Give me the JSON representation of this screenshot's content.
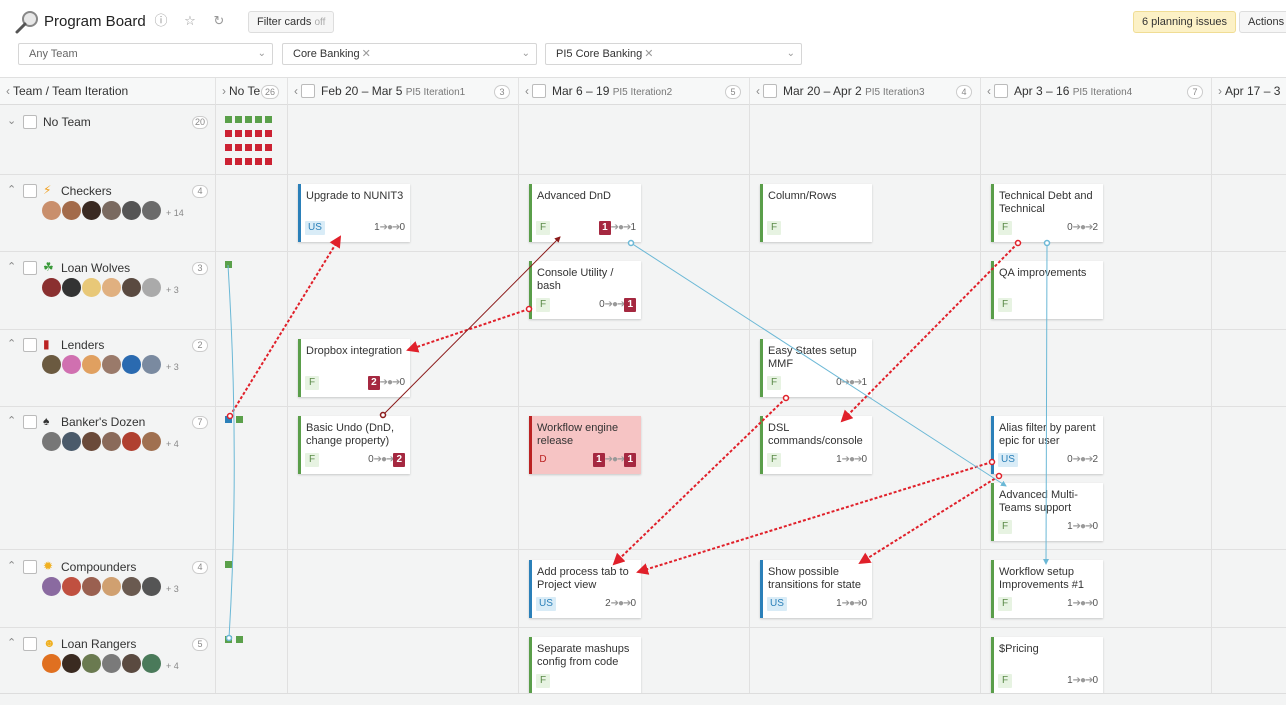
{
  "header": {
    "title": "Program Board",
    "filter_label": "Filter cards",
    "filter_state": "off",
    "planning_issues": "6 planning issues",
    "actions": "Actions"
  },
  "filters": {
    "team": "Any Team",
    "project": "Core Banking",
    "release": "PI5 Core Banking"
  },
  "columns": [
    {
      "label": "Team / Team Iteration"
    },
    {
      "label": "No Te",
      "count": "26"
    },
    {
      "label": "Feb 20 – Mar 5",
      "pi": "PI5 Iteration1",
      "count": "3"
    },
    {
      "label": "Mar 6 – 19",
      "pi": "PI5 Iteration2",
      "count": "5"
    },
    {
      "label": "Mar 20 – Apr 2",
      "pi": "PI5 Iteration3",
      "count": "4"
    },
    {
      "label": "Apr 3 – 16",
      "pi": "PI5 Iteration4",
      "count": "7"
    },
    {
      "label": "Apr 17 – 3"
    }
  ],
  "teams": [
    {
      "name": "No Team",
      "count": "20",
      "icon": "",
      "more": ""
    },
    {
      "name": "Checkers",
      "count": "4",
      "icon": "lightning-icon",
      "more": "+ 14"
    },
    {
      "name": "Loan Wolves",
      "count": "3",
      "icon": "clover-icon",
      "more": "+ 3"
    },
    {
      "name": "Lenders",
      "count": "2",
      "icon": "book-icon",
      "more": "+ 3"
    },
    {
      "name": "Banker's Dozen",
      "count": "7",
      "icon": "spade-icon",
      "more": "+ 4"
    },
    {
      "name": "Compounders",
      "count": "4",
      "icon": "sun-icon",
      "more": "+ 3"
    },
    {
      "name": "Loan Rangers",
      "count": "5",
      "icon": "sunglasses-icon",
      "more": "+ 4"
    }
  ],
  "cards": [
    {
      "title": "Upgrade to NUNIT3",
      "type": "US",
      "deps_in": "1",
      "deps_out": "0"
    },
    {
      "title": "Advanced DnD",
      "type": "F",
      "deps_in": "1",
      "deps_out": "1"
    },
    {
      "title": "Column/Rows",
      "type": "F",
      "deps_in": "",
      "deps_out": ""
    },
    {
      "title": "Technical Debt and Technical",
      "type": "F",
      "deps_in": "0",
      "deps_out": "2"
    },
    {
      "title": "Console Utility / bash",
      "type": "F",
      "deps_in": "0",
      "deps_out": "1"
    },
    {
      "title": "QA improvements",
      "type": "F",
      "deps_in": "",
      "deps_out": ""
    },
    {
      "title": "Dropbox integration",
      "type": "F",
      "deps_in": "2",
      "deps_out": "0"
    },
    {
      "title": "Easy States setup MMF",
      "type": "F",
      "deps_in": "0",
      "deps_out": "1"
    },
    {
      "title": "Basic Undo (DnD, change property)",
      "type": "F",
      "deps_in": "0",
      "deps_out": "2"
    },
    {
      "title": "Workflow engine release",
      "type": "D",
      "deps_in": "1",
      "deps_out": "1"
    },
    {
      "title": "DSL commands/console",
      "type": "F",
      "deps_in": "1",
      "deps_out": "0"
    },
    {
      "title": "Alias filter by parent epic for user",
      "type": "US",
      "deps_in": "0",
      "deps_out": "2"
    },
    {
      "title": "Advanced Multi-Teams support",
      "type": "F",
      "deps_in": "1",
      "deps_out": "0"
    },
    {
      "title": "Add process tab to Project view",
      "type": "US",
      "deps_in": "2",
      "deps_out": "0"
    },
    {
      "title": "Show possible transitions for state",
      "type": "US",
      "deps_in": "1",
      "deps_out": "0"
    },
    {
      "title": "Workflow setup Improvements #1",
      "type": "F",
      "deps_in": "1",
      "deps_out": "0"
    },
    {
      "title": "Separate mashups config from code",
      "type": "F",
      "deps_in": "",
      "deps_out": ""
    },
    {
      "title": "$Pricing",
      "type": "F",
      "deps_in": "1",
      "deps_out": "0"
    }
  ],
  "colors": {
    "feature": "#5a9e4a",
    "story": "#2b80b9",
    "defect": "#b22222",
    "badge_red": "#a52840",
    "link_red": "#e0202a",
    "link_blue": "#6bb8d6"
  }
}
